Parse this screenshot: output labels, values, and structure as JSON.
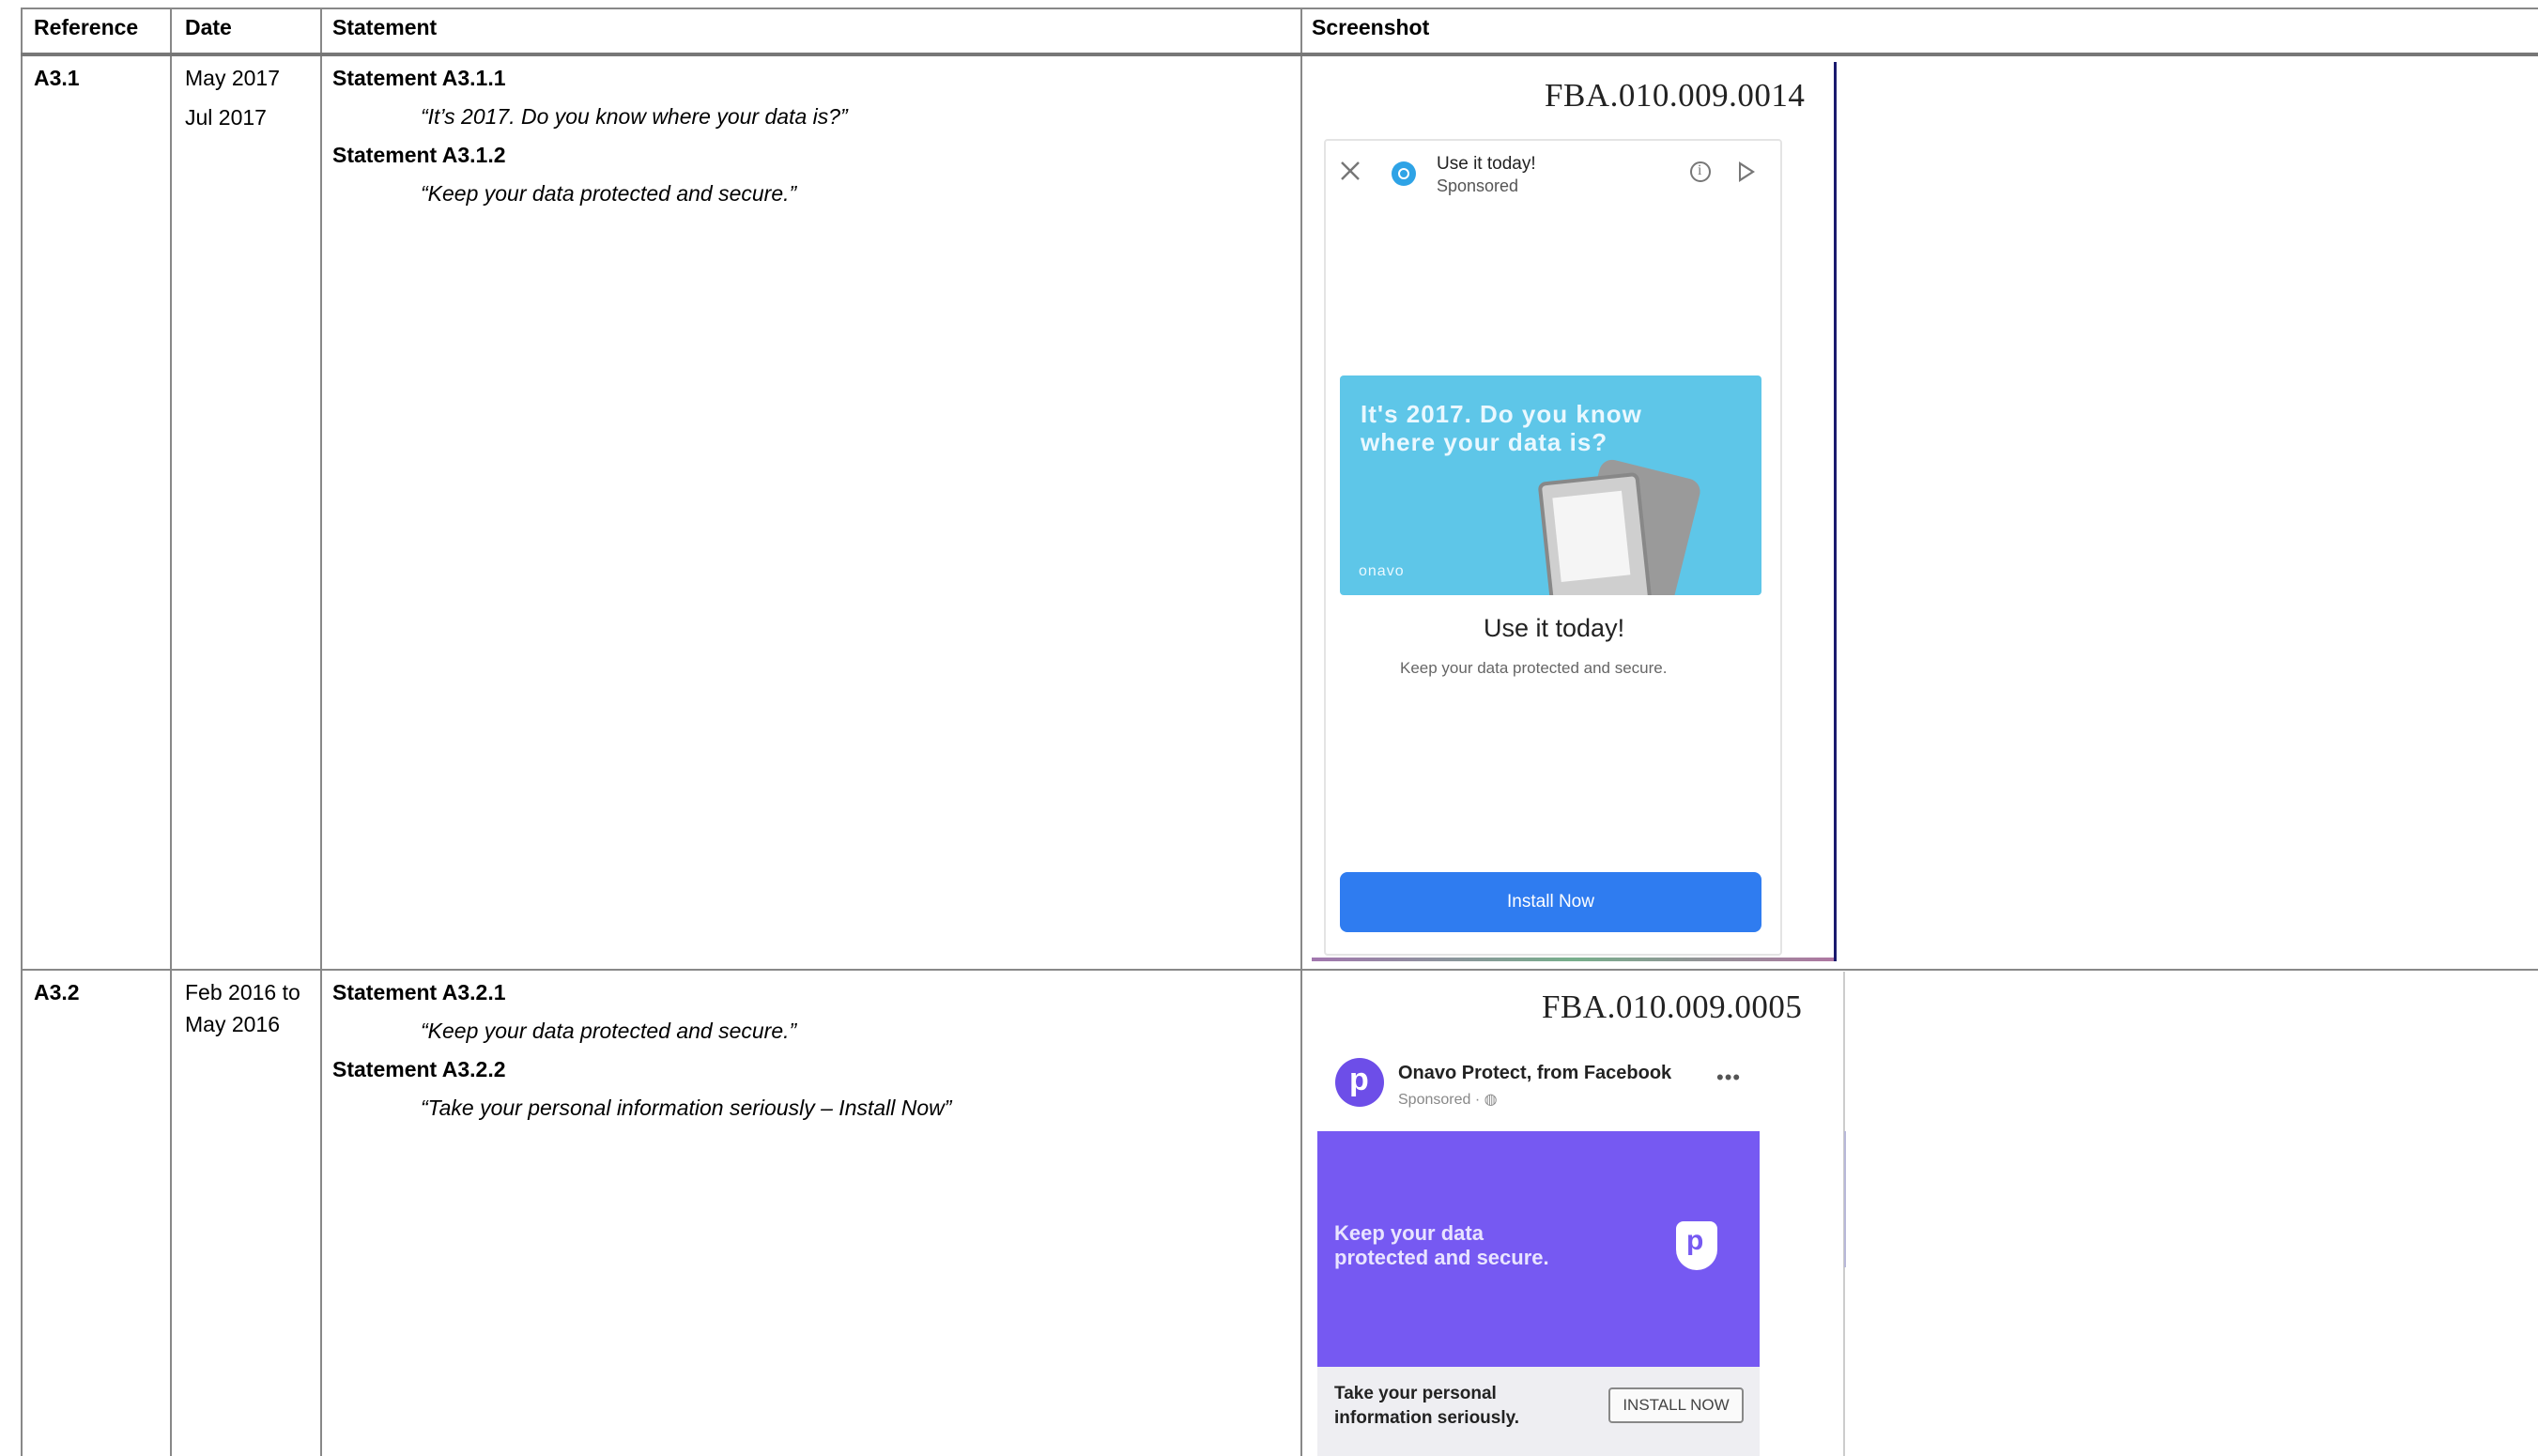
{
  "headers": {
    "reference": "Reference",
    "date": "Date",
    "statement": "Statement",
    "screenshot": "Screenshot"
  },
  "rows": [
    {
      "reference": "A3.1",
      "dates": [
        "May 2017",
        "Jul 2017"
      ],
      "statements": [
        {
          "title": "Statement A3.1.1",
          "quote": "“It’s 2017. Do you know where your data is?”"
        },
        {
          "title": "Statement A3.1.2",
          "quote": "“Keep your data protected and secure.”"
        }
      ],
      "screenshot": {
        "doc_id": "FBA.010.009.0014",
        "ad_title": "Use it today!",
        "ad_sponsored": "Sponsored",
        "banner_text": "It's 2017. Do you know where your data is?",
        "banner_brand": "onavo",
        "headline": "Use it today!",
        "body": "Keep your data protected and secure.",
        "cta": "Install Now"
      }
    },
    {
      "reference": "A3.2",
      "dates": [
        "Feb 2016 to",
        "May 2016"
      ],
      "statements": [
        {
          "title": "Statement A3.2.1",
          "quote": "“Keep your data protected and secure.”"
        },
        {
          "title": "Statement A3.2.2",
          "quote": "“Take your personal information seriously – Install Now”"
        }
      ],
      "screenshot": {
        "doc_id": "FBA.010.009.0005",
        "page_name": "Onavo Protect, from Facebook",
        "sponsored": "Sponsored · ◍",
        "more": "•••",
        "banner_text": "Keep your data protected and secure.",
        "footer_text": "Take your personal information seriously.",
        "cta": "INSTALL NOW"
      }
    }
  ],
  "colors": {
    "banner1": "#5ec6e8",
    "install_button": "#2f7cf0",
    "banner2": "#7659f2",
    "onavo_icon": "#2ea3e6"
  }
}
